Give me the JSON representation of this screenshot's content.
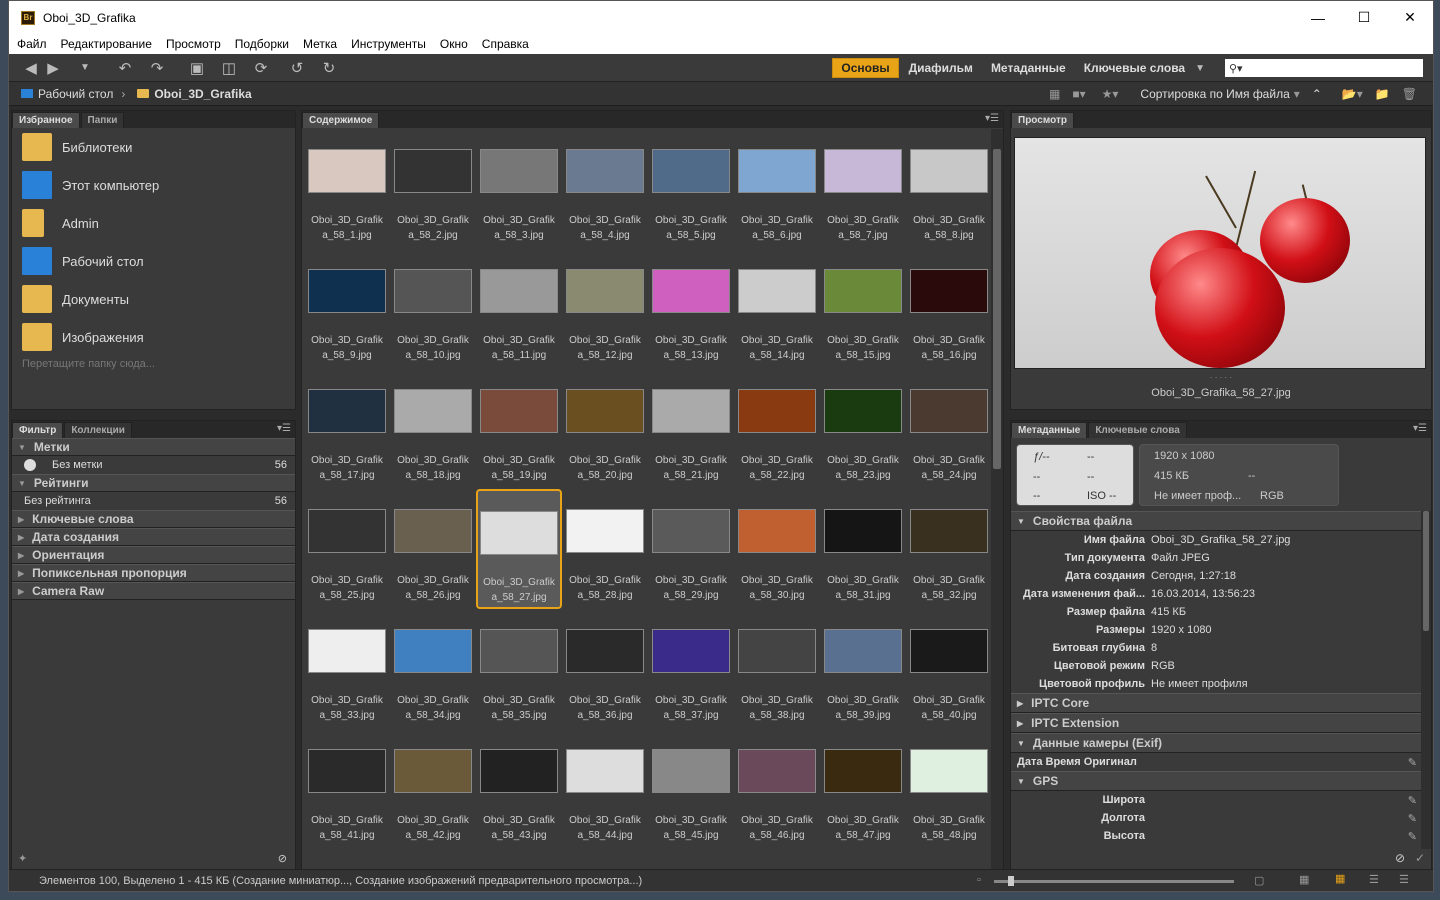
{
  "window": {
    "title": "Oboi_3D_Grafika",
    "app_icon": "Br"
  },
  "menu": [
    "Файл",
    "Редактирование",
    "Просмотр",
    "Подборки",
    "Метка",
    "Инструменты",
    "Окно",
    "Справка"
  ],
  "workspaces": [
    "Основы",
    "Диафильм",
    "Метаданные",
    "Ключевые слова"
  ],
  "path": [
    "Рабочий стол",
    "Oboi_3D_Grafika"
  ],
  "sort_label": "Сортировка по Имя файла",
  "left_tabs": [
    "Избранное",
    "Папки"
  ],
  "favorites": [
    {
      "label": "Библиотеки",
      "icon": "libraries-icon"
    },
    {
      "label": "Этот компьютер",
      "icon": "computer-icon"
    },
    {
      "label": "Admin",
      "icon": "folder-icon"
    },
    {
      "label": "Рабочий стол",
      "icon": "desktop-icon"
    },
    {
      "label": "Документы",
      "icon": "documents-icon"
    },
    {
      "label": "Изображения",
      "icon": "images-icon"
    }
  ],
  "fav_hint": "Перетащите папку сюда...",
  "filter_tabs": [
    "Фильтр",
    "Коллекции"
  ],
  "filters": {
    "labels_title": "Метки",
    "no_label": "Без метки",
    "no_label_count": "56",
    "ratings_title": "Рейтинги",
    "no_rating": "Без рейтинга",
    "no_rating_count": "56",
    "groups": [
      "Ключевые слова",
      "Дата создания",
      "Ориентация",
      "Попиксельная пропорция",
      "Camera Raw"
    ]
  },
  "content_tab": "Содержимое",
  "files": [
    {
      "n": "Oboi_3D_Grafik",
      "e": "a_58_1.jpg",
      "c": "#d9c8c0"
    },
    {
      "n": "Oboi_3D_Grafik",
      "e": "a_58_2.jpg",
      "c": "#333"
    },
    {
      "n": "Oboi_3D_Grafik",
      "e": "a_58_3.jpg",
      "c": "#777"
    },
    {
      "n": "Oboi_3D_Grafik",
      "e": "a_58_4.jpg",
      "c": "#6a7a90"
    },
    {
      "n": "Oboi_3D_Grafik",
      "e": "a_58_5.jpg",
      "c": "#506a8a"
    },
    {
      "n": "Oboi_3D_Grafik",
      "e": "a_58_6.jpg",
      "c": "#7ea6d0"
    },
    {
      "n": "Oboi_3D_Grafik",
      "e": "a_58_7.jpg",
      "c": "#c8b8d8"
    },
    {
      "n": "Oboi_3D_Grafik",
      "e": "a_58_8.jpg",
      "c": "#c8c8c8"
    },
    {
      "n": "Oboi_3D_Grafik",
      "e": "a_58_9.jpg",
      "c": "#103050"
    },
    {
      "n": "Oboi_3D_Grafik",
      "e": "a_58_10.jpg",
      "c": "#555"
    },
    {
      "n": "Oboi_3D_Grafik",
      "e": "a_58_11.jpg",
      "c": "#999"
    },
    {
      "n": "Oboi_3D_Grafik",
      "e": "a_58_12.jpg",
      "c": "#8a8a70"
    },
    {
      "n": "Oboi_3D_Grafik",
      "e": "a_58_13.jpg",
      "c": "#d060c0"
    },
    {
      "n": "Oboi_3D_Grafik",
      "e": "a_58_14.jpg",
      "c": "#ccc"
    },
    {
      "n": "Oboi_3D_Grafik",
      "e": "a_58_15.jpg",
      "c": "#6a8a3a"
    },
    {
      "n": "Oboi_3D_Grafik",
      "e": "a_58_16.jpg",
      "c": "#2a0a0a"
    },
    {
      "n": "Oboi_3D_Grafik",
      "e": "a_58_17.jpg",
      "c": "#203040"
    },
    {
      "n": "Oboi_3D_Grafik",
      "e": "a_58_18.jpg",
      "c": "#aaa"
    },
    {
      "n": "Oboi_3D_Grafik",
      "e": "a_58_19.jpg",
      "c": "#7a4a3a"
    },
    {
      "n": "Oboi_3D_Grafik",
      "e": "a_58_20.jpg",
      "c": "#6a5020"
    },
    {
      "n": "Oboi_3D_Grafik",
      "e": "a_58_21.jpg",
      "c": "#aaa"
    },
    {
      "n": "Oboi_3D_Grafik",
      "e": "a_58_22.jpg",
      "c": "#8a3a10"
    },
    {
      "n": "Oboi_3D_Grafik",
      "e": "a_58_23.jpg",
      "c": "#1a3a10"
    },
    {
      "n": "Oboi_3D_Grafik",
      "e": "a_58_24.jpg",
      "c": "#4a3a30"
    },
    {
      "n": "Oboi_3D_Grafik",
      "e": "a_58_25.jpg",
      "c": "#333"
    },
    {
      "n": "Oboi_3D_Grafik",
      "e": "a_58_26.jpg",
      "c": "#6a6050"
    },
    {
      "n": "Oboi_3D_Grafik",
      "e": "a_58_27.jpg",
      "c": "#ddd"
    },
    {
      "n": "Oboi_3D_Grafik",
      "e": "a_58_28.jpg",
      "c": "#f2f2f2"
    },
    {
      "n": "Oboi_3D_Grafik",
      "e": "a_58_29.jpg",
      "c": "#5a5a5a"
    },
    {
      "n": "Oboi_3D_Grafik",
      "e": "a_58_30.jpg",
      "c": "#c06030"
    },
    {
      "n": "Oboi_3D_Grafik",
      "e": "a_58_31.jpg",
      "c": "#151515"
    },
    {
      "n": "Oboi_3D_Grafik",
      "e": "a_58_32.jpg",
      "c": "#3a3020"
    },
    {
      "n": "Oboi_3D_Grafik",
      "e": "a_58_33.jpg",
      "c": "#eee"
    },
    {
      "n": "Oboi_3D_Grafik",
      "e": "a_58_34.jpg",
      "c": "#4080c0"
    },
    {
      "n": "Oboi_3D_Grafik",
      "e": "a_58_35.jpg",
      "c": "#555"
    },
    {
      "n": "Oboi_3D_Grafik",
      "e": "a_58_36.jpg",
      "c": "#2a2a2a"
    },
    {
      "n": "Oboi_3D_Grafik",
      "e": "a_58_37.jpg",
      "c": "#3a2a8a"
    },
    {
      "n": "Oboi_3D_Grafik",
      "e": "a_58_38.jpg",
      "c": "#444"
    },
    {
      "n": "Oboi_3D_Grafik",
      "e": "a_58_39.jpg",
      "c": "#5a7090"
    },
    {
      "n": "Oboi_3D_Grafik",
      "e": "a_58_40.jpg",
      "c": "#1a1a1a"
    },
    {
      "n": "Oboi_3D_Grafik",
      "e": "a_58_41.jpg",
      "c": "#2a2a2a"
    },
    {
      "n": "Oboi_3D_Grafik",
      "e": "a_58_42.jpg",
      "c": "#6a5a3a"
    },
    {
      "n": "Oboi_3D_Grafik",
      "e": "a_58_43.jpg",
      "c": "#222"
    },
    {
      "n": "Oboi_3D_Grafik",
      "e": "a_58_44.jpg",
      "c": "#ddd"
    },
    {
      "n": "Oboi_3D_Grafik",
      "e": "a_58_45.jpg",
      "c": "#888"
    },
    {
      "n": "Oboi_3D_Grafik",
      "e": "a_58_46.jpg",
      "c": "#6a4a5a"
    },
    {
      "n": "Oboi_3D_Grafik",
      "e": "a_58_47.jpg",
      "c": "#3a2a10"
    },
    {
      "n": "Oboi_3D_Grafik",
      "e": "a_58_48.jpg",
      "c": "#e0f0e0"
    }
  ],
  "selected_index": 26,
  "preview_tab": "Просмотр",
  "preview_name": "Oboi_3D_Grafika_58_27.jpg",
  "preview_dots": "· · · · ·",
  "meta_tabs": [
    "Метаданные",
    "Ключевые слова"
  ],
  "camera": {
    "f": "ƒ/--",
    "dash": "--",
    "iso": "ISO --",
    "dims": "1920 x 1080",
    "size": "415 КБ",
    "profile": "Не имеет проф...",
    "mode": "RGB"
  },
  "file_props_title": "Свойства файла",
  "file_props": [
    {
      "k": "Имя файла",
      "v": "Oboi_3D_Grafika_58_27.jpg"
    },
    {
      "k": "Тип документа",
      "v": "Файл JPEG"
    },
    {
      "k": "Дата создания",
      "v": "Сегодня, 1:27:18"
    },
    {
      "k": "Дата изменения фай...",
      "v": "16.03.2014, 13:56:23"
    },
    {
      "k": "Размер файла",
      "v": "415 КБ"
    },
    {
      "k": "Размеры",
      "v": "1920 x 1080"
    },
    {
      "k": "Битовая глубина",
      "v": "8"
    },
    {
      "k": "Цветовой режим",
      "v": "RGB"
    },
    {
      "k": "Цветовой профиль",
      "v": "Не имеет профиля"
    }
  ],
  "sections": [
    "IPTC Core",
    "IPTC Extension",
    "Данные камеры (Exif)"
  ],
  "exif_row": "Дата Время Оригинал",
  "gps_title": "GPS",
  "gps_rows": [
    "Широта",
    "Долгота",
    "Высота"
  ],
  "status": "Элементов 100, Выделено 1 - 415 КБ (Создание миниатюр..., Создание изображений предварительного просмотра...)",
  "colors": {
    "accent": "#e8a317"
  }
}
